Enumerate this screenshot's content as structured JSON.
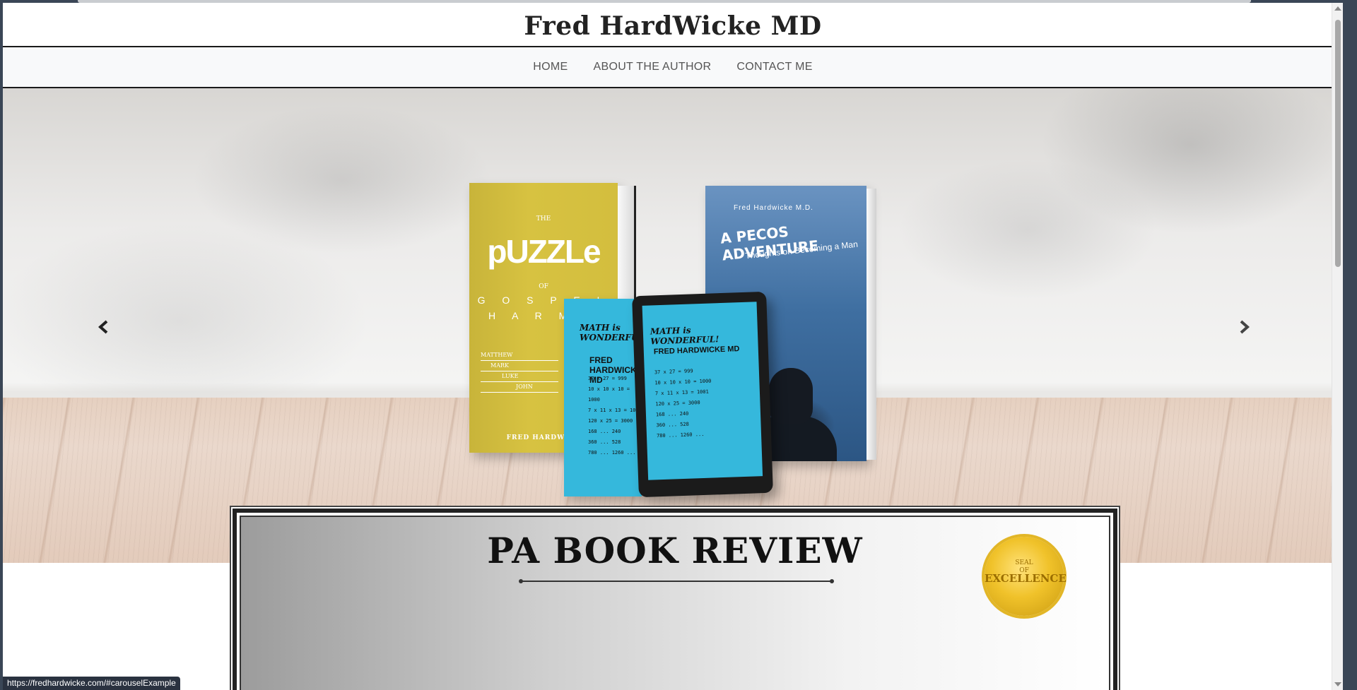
{
  "site": {
    "title": "Fred HardWicke MD"
  },
  "nav": {
    "items": [
      "HOME",
      "ABOUT THE AUTHOR",
      "CONTACT ME"
    ]
  },
  "carousel": {
    "prev_icon": "chevron-left-icon",
    "next_icon": "chevron-right-icon",
    "books": {
      "puzzle": {
        "the": "THE",
        "title": "pUZZLe",
        "of": "OF",
        "line1": "G O S P E L",
        "line2": "H A R M O",
        "gospels": [
          "MATTHEW",
          "MARK",
          "LUKE",
          "JOHN"
        ],
        "author": "FRED HARDWICK"
      },
      "math": {
        "title": "MATH is WONDERFUL!",
        "author": "FRED HARDWICKE MD",
        "lines": [
          "37 x 27 = 999",
          "10 x 10 x 10 = 1000",
          "7 x 11 x 13 = 1001",
          "120 x 25 = 3000",
          "168 ... 240",
          "360 ... 528",
          "780 ... 1260 ..."
        ]
      },
      "pecos": {
        "author": "Fred Hardwicke M.D.",
        "title": "A PECOS ADVENTURE",
        "subtitle": "Thoughts on Becoming a Man"
      }
    }
  },
  "review": {
    "title": "PA BOOK REVIEW",
    "seal_top": "SEAL",
    "seal_of": "OF",
    "seal_main": "EXCELLENCE"
  },
  "status_bar": {
    "url": "https://fredhardwicke.com/#carouselExample"
  },
  "colors": {
    "nav_bg": "#f8f9fa",
    "rule": "#1a1a1a",
    "accent_cyan": "#35b8dc",
    "accent_yellow": "#d7c241"
  }
}
